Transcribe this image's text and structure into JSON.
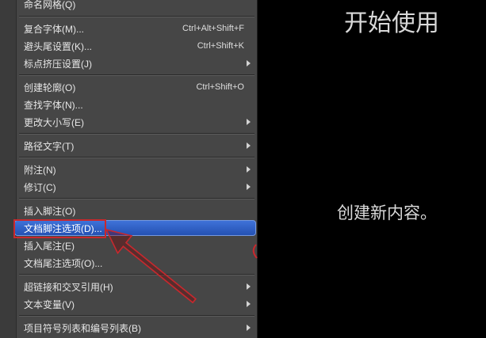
{
  "colors": {
    "menu_background": "#464646",
    "menu_text": "#e6e6e6",
    "highlight_top": "#3f72d8",
    "highlight_bottom": "#2451b3",
    "annotation": "#c8282d",
    "page_background": "#000000",
    "home_text": "#d9d9d9"
  },
  "menu": {
    "items": [
      {
        "label": "命名网格(Q)"
      },
      {
        "label": "复合字体(M)...",
        "shortcut": "Ctrl+Alt+Shift+F"
      },
      {
        "label": "避头尾设置(K)...",
        "shortcut": "Ctrl+Shift+K"
      },
      {
        "label": "标点挤压设置(J)",
        "submenu": true
      },
      {
        "label": "创建轮廓(O)",
        "shortcut": "Ctrl+Shift+O"
      },
      {
        "label": "查找字体(N)..."
      },
      {
        "label": "更改大小写(E)",
        "submenu": true
      },
      {
        "label": "路径文字(T)",
        "submenu": true
      },
      {
        "label": "附注(N)",
        "submenu": true
      },
      {
        "label": "修订(C)",
        "submenu": true
      },
      {
        "label": "插入脚注(O)"
      },
      {
        "label": "文档脚注选项(D)...",
        "highlighted": true
      },
      {
        "label": "插入尾注(E)"
      },
      {
        "label": "文档尾注选项(O)..."
      },
      {
        "label": "超链接和交叉引用(H)",
        "submenu": true
      },
      {
        "label": "文本变量(V)",
        "submenu": true
      },
      {
        "label": "项目符号列表和编号列表(B)",
        "submenu": true
      }
    ],
    "submenu_icon": "chevron-right-icon"
  },
  "home": {
    "title": "开始使用",
    "subtitle": "创建新内容。"
  }
}
